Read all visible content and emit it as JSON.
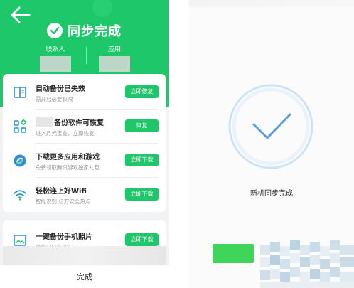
{
  "left": {
    "title": "同步完成",
    "stats": [
      {
        "label": "联系人"
      },
      {
        "label": "应用"
      }
    ],
    "rows": [
      {
        "title": "自动备份已失效",
        "subtitle": "需开启必要权限",
        "button": "立即修复",
        "icon": "book-icon"
      },
      {
        "title": "备份软件可恢复",
        "subtitle": "进入月光宝盒，立即恢复",
        "button": "恢复",
        "icon": "apps-grid-icon"
      },
      {
        "title": "下载更多应用和游戏",
        "subtitle": "免费领取腾讯游戏独家礼包",
        "button": "立即下载",
        "icon": "app-store-icon"
      },
      {
        "title": "轻松连上好Wifi",
        "subtitle": "智能识别 亿万安全热点",
        "button": "立即下载",
        "icon": "wifi-icon"
      }
    ],
    "photo_row": {
      "title": "一键备份手机照片",
      "subtitle": "精彩回忆永留存",
      "button": "立即下载",
      "icon": "image-icon"
    },
    "done_label": "完成"
  },
  "right": {
    "caption": "新机同步完成"
  },
  "colors": {
    "brand_green": "#1ec76a",
    "check_blue": "#5a9fdc",
    "pill_green": "#3fd55a"
  }
}
